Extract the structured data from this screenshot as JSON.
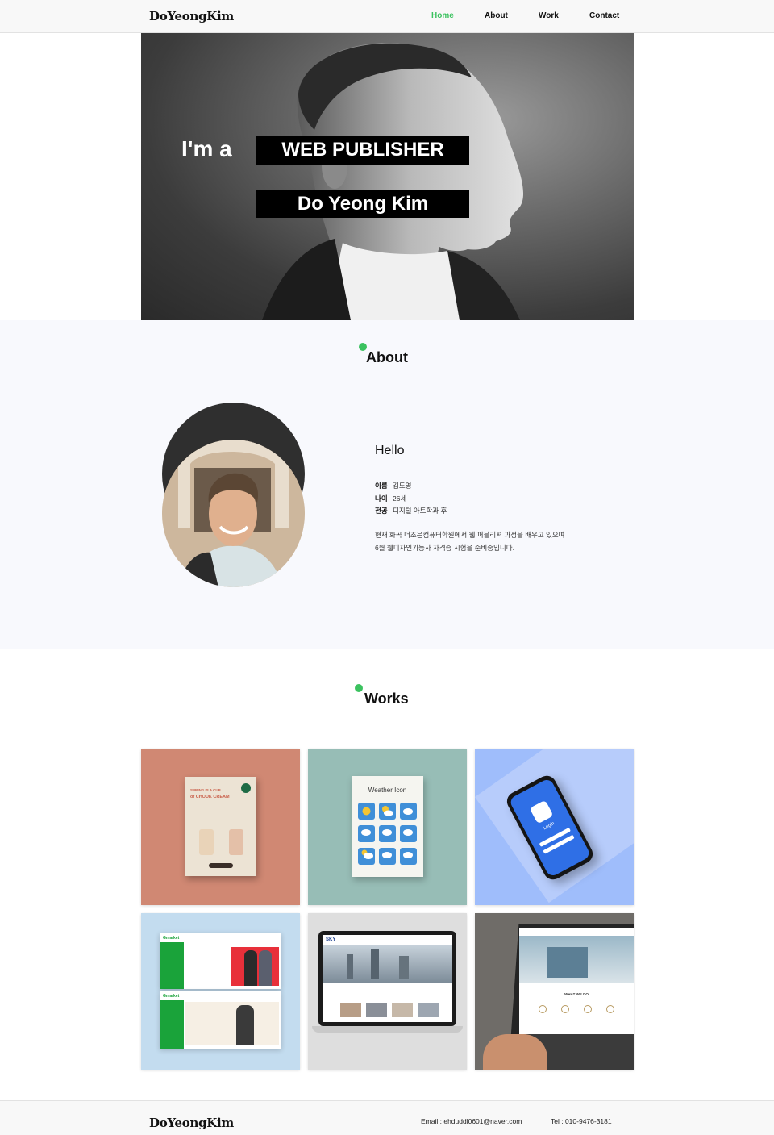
{
  "header": {
    "logo": "DoYeongKim",
    "nav": [
      {
        "label": "Home",
        "active": true
      },
      {
        "label": "About",
        "active": false
      },
      {
        "label": "Work",
        "active": false
      },
      {
        "label": "Contact",
        "active": false
      }
    ]
  },
  "hero": {
    "intro": "I'm a",
    "role": "WEB PUBLISHER",
    "name": "Do Yeong Kim"
  },
  "about": {
    "title": "About",
    "greeting": "Hello",
    "info": [
      {
        "key": "이름",
        "value": "김도영"
      },
      {
        "key": "나이",
        "value": "26세"
      },
      {
        "key": "전공",
        "value": "디지털 아트학과 후"
      }
    ],
    "desc_line1": "현재 화곡 더조은컴퓨터학원에서 웹 퍼블리셔 과정을 배우고 있으며",
    "desc_line2": "6월 웹디자인기능사 자격증 시험을 준비중입니다."
  },
  "works": {
    "title": "Works",
    "items": [
      {
        "caption_title": "SPRING IS A CUP",
        "caption_sub": "of CHOUK CREAM",
        "bg": "#d08873"
      },
      {
        "caption_title": "Weather Icon",
        "bg": "#97bdb6"
      },
      {
        "caption_title": "Login",
        "bg": "#9fbdfb"
      },
      {
        "caption_title": "Gmarket",
        "bg": "#c3dcef"
      },
      {
        "caption_title": "SKY",
        "bg": "#d9d9d9"
      },
      {
        "caption_title": "WHAT WE DO",
        "bg": "#6f6c68"
      }
    ]
  },
  "footer": {
    "logo": "DoYeongKim",
    "email": "Email : ehduddl0601@naver.com",
    "tel": "Tel : 010-9476-3181"
  },
  "colors": {
    "accent": "#3bc25f",
    "hero_box": "#000000",
    "about_bg": "#f8f9fd"
  }
}
